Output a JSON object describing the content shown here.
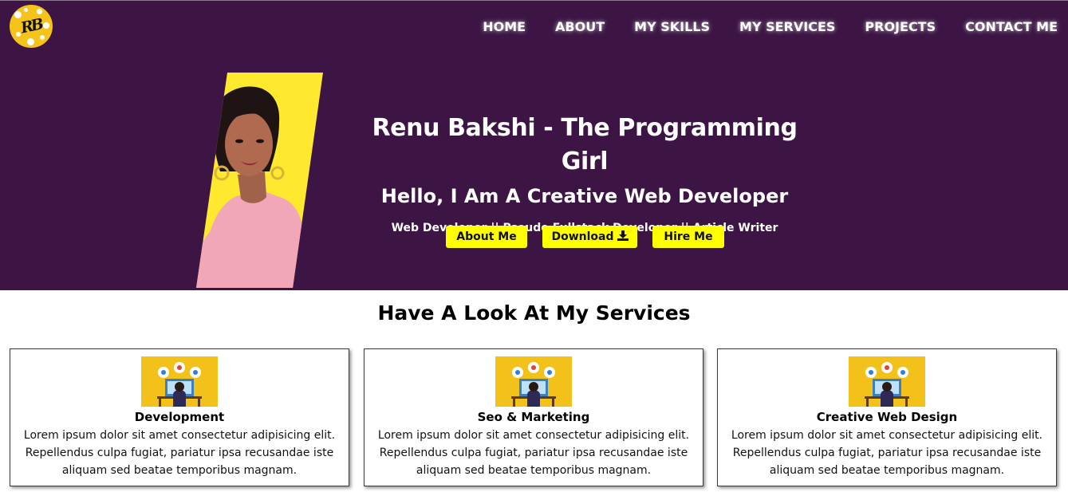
{
  "brand": {
    "logo_monogram": "RB",
    "logo_colors": {
      "bg": "#f5c41a",
      "ink": "#111111"
    }
  },
  "nav": {
    "items": [
      {
        "label": "HOME"
      },
      {
        "label": "ABOUT"
      },
      {
        "label": "MY SKILLS"
      },
      {
        "label": "MY SERVICES"
      },
      {
        "label": "PROJECTS"
      },
      {
        "label": "CONTACT ME"
      }
    ]
  },
  "hero": {
    "title": "Renu Bakshi - The Programming Girl",
    "subtitle": "Hello, I Am A Creative Web Developer",
    "roles": "Web Developer || Pseudo Fullstack Developer || Article Writer",
    "photo_icon": "profile-photo",
    "buttons": {
      "about": "About Me",
      "download": "Download",
      "download_icon": "download-icon",
      "hire": "Hire Me"
    }
  },
  "services": {
    "heading": "Have A Look At My Services",
    "cards": [
      {
        "title": "Development",
        "text": "Lorem ipsum dolor sit amet consectetur adipisicing elit. Repellendus culpa fugiat, pariatur ipsa recusandae iste aliquam sed beatae temporibus magnam."
      },
      {
        "title": "Seo & Marketing",
        "text": "Lorem ipsum dolor sit amet consectetur adipisicing elit. Repellendus culpa fugiat, pariatur ipsa recusandae iste aliquam sed beatae temporibus magnam."
      },
      {
        "title": "Creative Web Design",
        "text": "Lorem ipsum dolor sit amet consectetur adipisicing elit. Repellendus culpa fugiat, pariatur ipsa recusandae iste aliquam sed beatae temporibus magnam."
      }
    ]
  },
  "colors": {
    "hero_bg": "#3c1544",
    "accent_yellow": "#ffff00",
    "photo_panel": "#ffe92e",
    "card_border": "#3a3a3a"
  }
}
